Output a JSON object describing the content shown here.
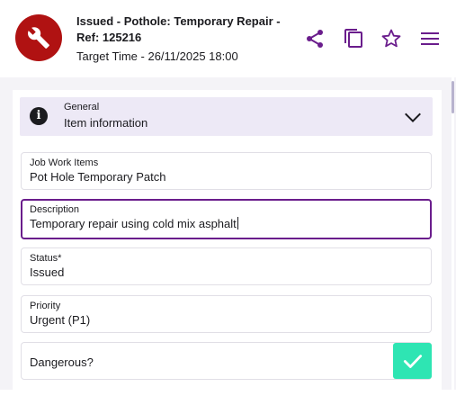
{
  "header": {
    "title_line1": "Issued - Pothole: Temporary Repair -",
    "title_line2": "Ref: 125216",
    "target_time": "Target Time - 26/11/2025 18:00",
    "icons": [
      "wrench-icon",
      "share-icon",
      "copy-icon",
      "star-icon",
      "menu-icon"
    ]
  },
  "section": {
    "subtitle": "General",
    "title": "Item information",
    "icon": "info-icon",
    "expanded": true
  },
  "fields": {
    "job_work_items": {
      "label": "Job Work Items",
      "value": "Pot Hole Temporary Patch"
    },
    "description": {
      "label": "Description",
      "value": "Temporary repair using cold mix asphalt"
    },
    "status": {
      "label": "Status*",
      "value": "Issued"
    },
    "priority": {
      "label": "Priority",
      "value": "Urgent (P1)"
    },
    "dangerous": {
      "label": "Dangerous?",
      "checked": true
    }
  },
  "colors": {
    "brand_red": "#b01212",
    "accent_purple": "#6a1d8c",
    "check_green": "#2ee5b3",
    "section_bg": "#ede9f6"
  }
}
